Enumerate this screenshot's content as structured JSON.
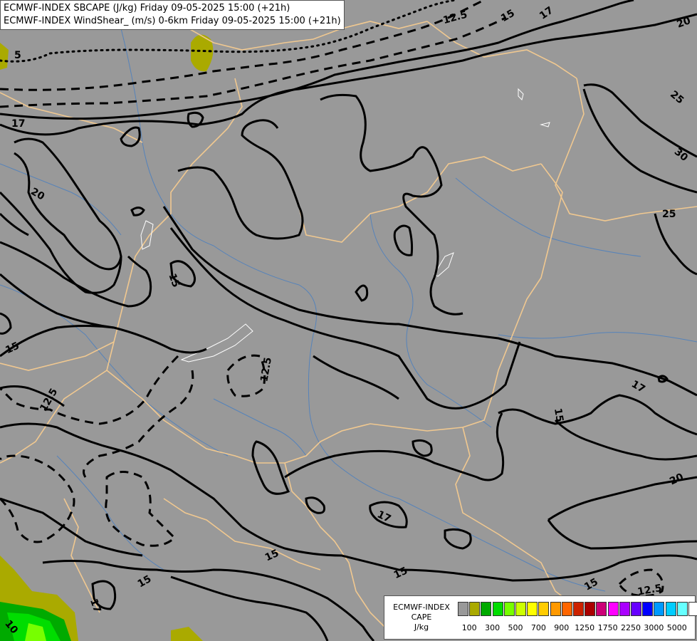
{
  "header": {
    "line1": "ECMWF-INDEX SBCAPE (J/kg) Friday 09-05-2025 15:00 (+21h)",
    "line2": "ECMWF-INDEX WindShear_ (m/s) 0-6km Friday 09-05-2025 15:00 (+21h)"
  },
  "contour_labels": [
    "5",
    "12.5",
    "15",
    "17",
    "20",
    "25",
    "30",
    "10"
  ],
  "legend": {
    "title_line1": "ECMWF-INDEX",
    "title_line2": "CAPE",
    "title_line3": "J/kg",
    "colors": [
      "#999999",
      "#aaaa00",
      "#00aa00",
      "#00dd00",
      "#77ff00",
      "#ccff00",
      "#ffff00",
      "#ffcc00",
      "#ff9900",
      "#ff6600",
      "#cc2200",
      "#aa0000",
      "#cc0077",
      "#ff00ff",
      "#aa00ff",
      "#6600ff",
      "#0000ff",
      "#0099ff",
      "#00ccff",
      "#66ffff",
      "#ffffff"
    ],
    "ticks": [
      "100",
      "300",
      "500",
      "700",
      "900",
      "1250",
      "1750",
      "2250",
      "3000",
      "5000"
    ]
  }
}
